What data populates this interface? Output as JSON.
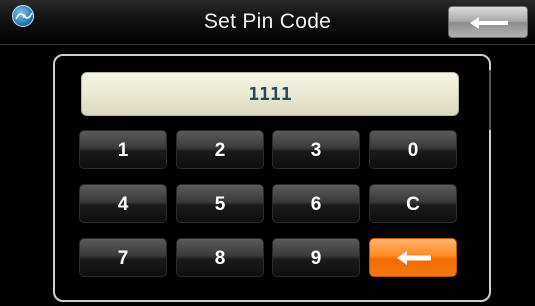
{
  "header": {
    "title": "Set Pin Code",
    "app_icon": "gps-globe-icon",
    "back_icon": "left-arrow-icon"
  },
  "pin_display": {
    "value": "1111"
  },
  "keypad": {
    "row1": [
      "1",
      "2",
      "3",
      "0"
    ],
    "row2": [
      "4",
      "5",
      "6",
      "C"
    ],
    "row3": [
      "7",
      "8",
      "9"
    ],
    "backspace_icon": "left-arrow-icon"
  },
  "colors": {
    "accent_orange": "#ff8a23",
    "key_dark": "#1a1a1a",
    "display_bg": "#ebe8d3",
    "display_text": "#26485e"
  }
}
